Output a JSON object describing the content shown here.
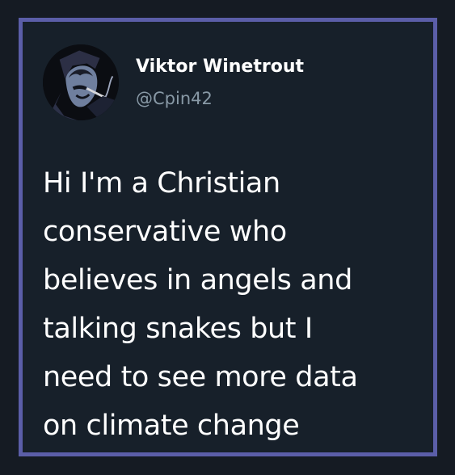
{
  "tweet": {
    "author": {
      "display_name": "Viktor Winetrout",
      "handle": "@Cpin42",
      "avatar_icon": "profile-photo-avatar"
    },
    "text_lines": [
      "Hi I'm a Christian",
      "conservative who",
      "believes in angels and",
      "talking snakes but I",
      "need to see more data",
      "on climate change"
    ]
  },
  "colors": {
    "background": "#17202a",
    "border": "#5b5ea8",
    "text": "#ffffff",
    "handle": "#8899a6"
  }
}
